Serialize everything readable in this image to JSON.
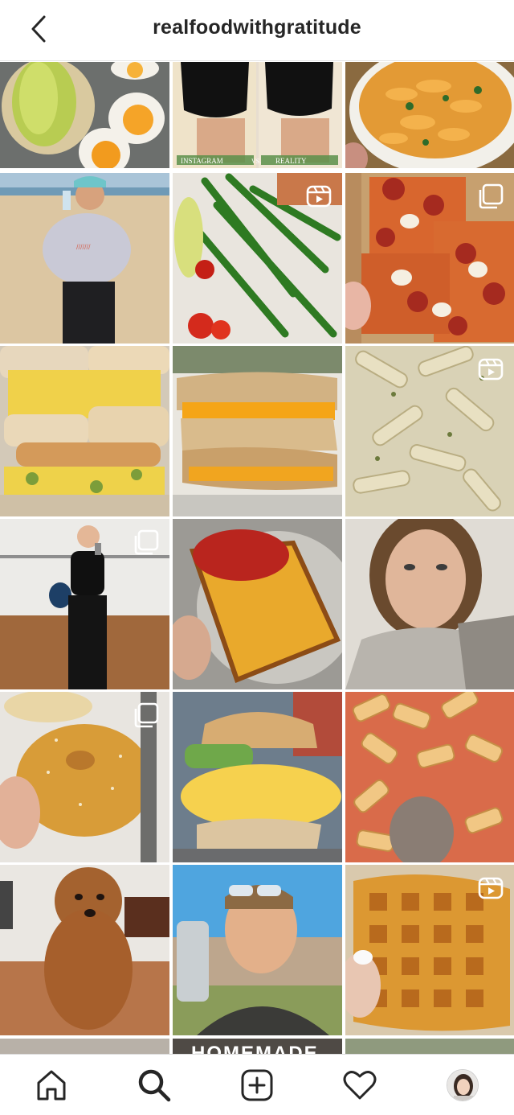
{
  "header": {
    "username": "realfoodwithgratitude",
    "back_icon": "chevron-left-icon"
  },
  "posts": [
    {
      "subject": "avocado toast with jammy eggs",
      "type": "photo"
    },
    {
      "subject": "instagram vs reality fitness comparison",
      "type": "photo",
      "overlay_text_left": "INSTAGRAM",
      "overlay_text_mid": "VS.",
      "overlay_text_right": "REALITY"
    },
    {
      "subject": "rotini pasta with herbs",
      "type": "photo"
    },
    {
      "subject": "woman drinking water on beach",
      "type": "photo"
    },
    {
      "subject": "roasted green beans with tomatoes and avocado",
      "type": "reel"
    },
    {
      "subject": "pepperoni pizza slices",
      "type": "carousel"
    },
    {
      "subject": "egg salad bagel sandwiches",
      "type": "photo"
    },
    {
      "subject": "grilled cheese sandwich",
      "type": "photo"
    },
    {
      "subject": "creamy penne pasta",
      "type": "reel"
    },
    {
      "subject": "gym mirror selfie",
      "type": "carousel"
    },
    {
      "subject": "toast with tomato jam",
      "type": "photo"
    },
    {
      "subject": "selfie in fleece jacket",
      "type": "photo"
    },
    {
      "subject": "sesame bagel",
      "type": "carousel"
    },
    {
      "subject": "egg and avocado biscuit sandwich",
      "type": "photo"
    },
    {
      "subject": "rigatoni in vodka sauce",
      "type": "photo"
    },
    {
      "subject": "goldendoodle dog",
      "type": "photo"
    },
    {
      "subject": "selfie with sunglasses",
      "type": "photo"
    },
    {
      "subject": "golden waffle",
      "type": "reel"
    }
  ],
  "partial_row_text": "HOMEMADE",
  "tabbar": {
    "items": [
      "home-icon",
      "search-icon",
      "new-post-icon",
      "activity-heart-icon",
      "profile-avatar"
    ],
    "active": "search-icon"
  },
  "colors": {
    "text": "#262626",
    "divider": "#dbdbdb",
    "background": "#ffffff"
  }
}
